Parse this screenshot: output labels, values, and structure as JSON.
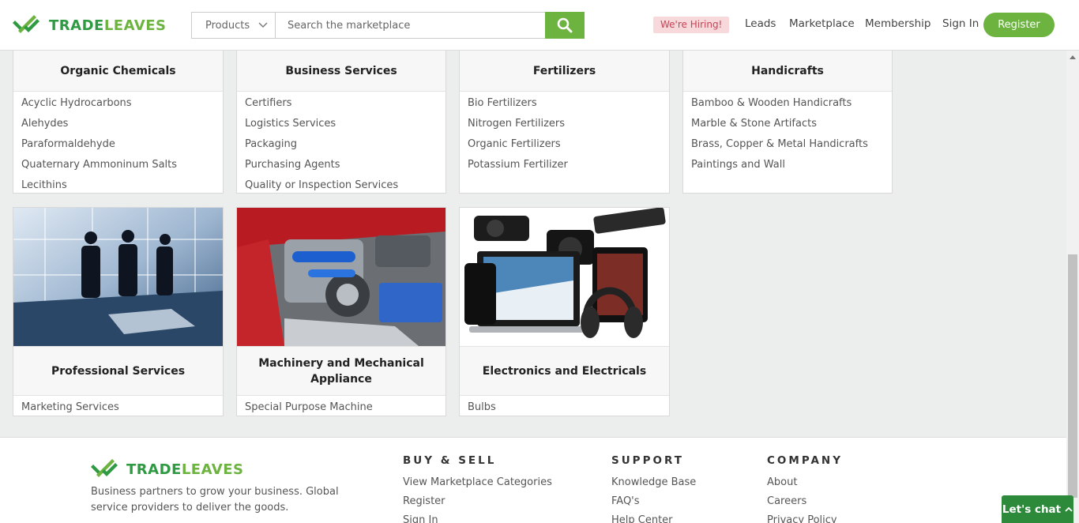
{
  "header": {
    "brand_trade": "TRADE",
    "brand_leaves": "LEAVES",
    "search": {
      "category": "Products",
      "placeholder": "Search the marketplace"
    },
    "hiring": "We're Hiring!",
    "nav": [
      "Leads",
      "Marketplace",
      "Membership",
      "Sign In"
    ],
    "register": "Register"
  },
  "categories_top": [
    {
      "title": "Organic Chemicals",
      "items": [
        "Acyclic Hydrocarbons",
        "Alehydes",
        "Paraformaldehyde",
        "Quaternary Ammoninum Salts",
        "Lecithins"
      ]
    },
    {
      "title": "Business Services",
      "items": [
        "Certifiers",
        "Logistics Services",
        "Packaging",
        "Purchasing Agents",
        "Quality or Inspection Services"
      ]
    },
    {
      "title": "Fertilizers",
      "items": [
        "Bio Fertilizers",
        "Nitrogen Fertilizers",
        "Organic Fertilizers",
        "Potassium Fertilizer"
      ]
    },
    {
      "title": "Handicrafts",
      "items": [
        "Bamboo & Wooden Handicrafts",
        "Marble & Stone Artifacts",
        "Brass, Copper & Metal Handicrafts",
        "Paintings and Wall"
      ]
    }
  ],
  "categories_image": [
    {
      "title": "Professional Services",
      "items": [
        "Marketing Services"
      ]
    },
    {
      "title": "Machinery and Mechanical Appliance",
      "items": [
        "Special Purpose Machine"
      ]
    },
    {
      "title": "Electronics and Electricals",
      "items": [
        "Bulbs"
      ]
    }
  ],
  "footer": {
    "brand_trade": "TRADE",
    "brand_leaves": "LEAVES",
    "description": "Business partners to grow your business. Global service providers to deliver the goods.",
    "buy_sell": {
      "title": "BUY & SELL",
      "links": [
        "View Marketplace Categories",
        "Register",
        "Sign In"
      ]
    },
    "support": {
      "title": "SUPPORT",
      "links": [
        "Knowledge Base",
        "FAQ's",
        "Help Center"
      ]
    },
    "company": {
      "title": "COMPANY",
      "links": [
        "About",
        "Careers",
        "Privacy Policy"
      ]
    }
  },
  "chat": {
    "label": "Let's chat"
  },
  "colors": {
    "brand_green": "#6cb33f",
    "brand_dark_green": "#2e9a42",
    "hiring_bg": "#f7d9dc",
    "chat_bg": "#2d8a3a"
  }
}
